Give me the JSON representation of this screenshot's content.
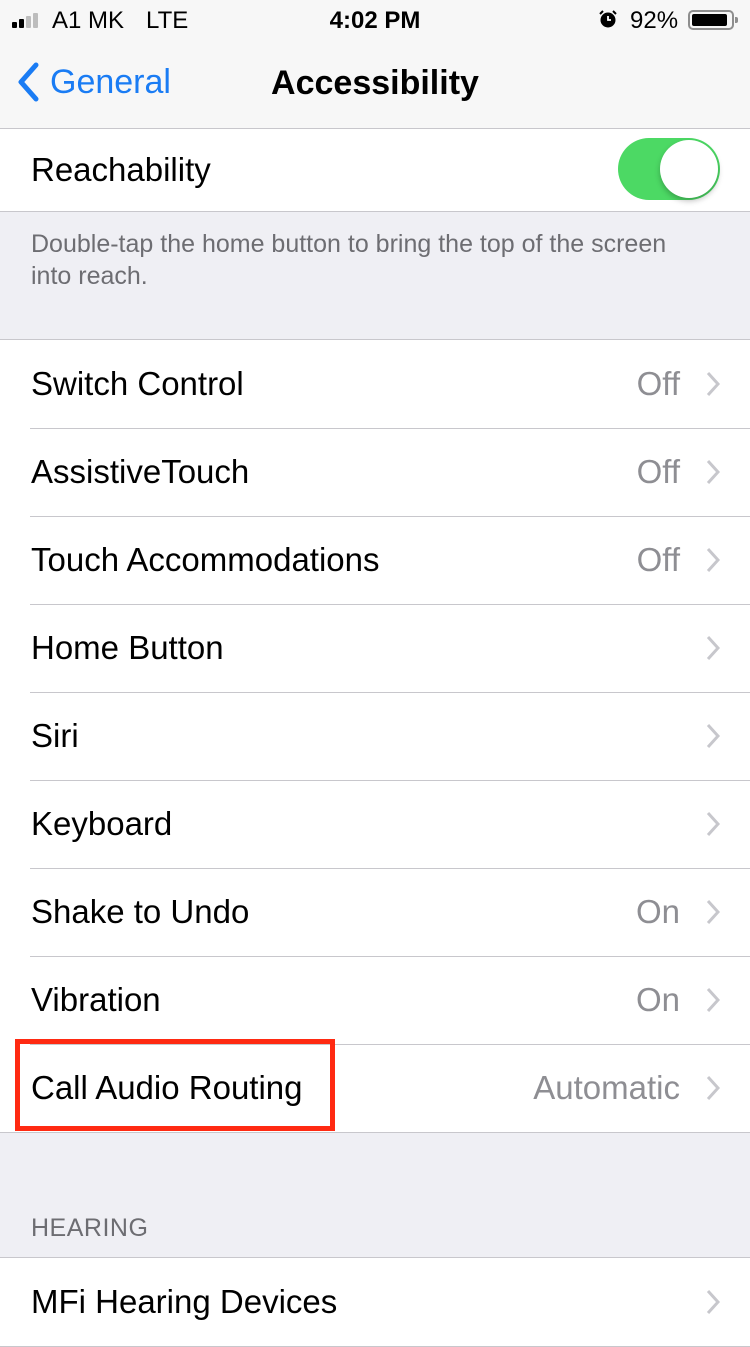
{
  "status_bar": {
    "carrier": "A1 MK",
    "network": "LTE",
    "time": "4:02 PM",
    "battery_percent_label": "92%",
    "battery_level": 0.92,
    "signal_bars": 2,
    "signal_bars_total": 4,
    "alarm_icon": "alarm-clock-icon"
  },
  "nav": {
    "back_label": "General",
    "title": "Accessibility",
    "accent_color": "#1a7cf4"
  },
  "reachability": {
    "label": "Reachability",
    "enabled": true,
    "toggle_color": "#4cd964",
    "footer": "Double-tap the home button to bring the top of the screen into reach."
  },
  "interaction": {
    "rows": [
      {
        "label": "Switch Control",
        "value": "Off"
      },
      {
        "label": "AssistiveTouch",
        "value": "Off"
      },
      {
        "label": "Touch Accommodations",
        "value": "Off"
      },
      {
        "label": "Home Button",
        "value": ""
      },
      {
        "label": "Siri",
        "value": ""
      },
      {
        "label": "Keyboard",
        "value": ""
      },
      {
        "label": "Shake to Undo",
        "value": "On"
      },
      {
        "label": "Vibration",
        "value": "On"
      },
      {
        "label": "Call Audio Routing",
        "value": "Automatic"
      }
    ]
  },
  "hearing": {
    "header": "HEARING",
    "rows": [
      {
        "label": "MFi Hearing Devices",
        "value": ""
      }
    ]
  },
  "annotation": {
    "highlighted_item": "Call Audio Routing",
    "color": "#ff2a12"
  }
}
